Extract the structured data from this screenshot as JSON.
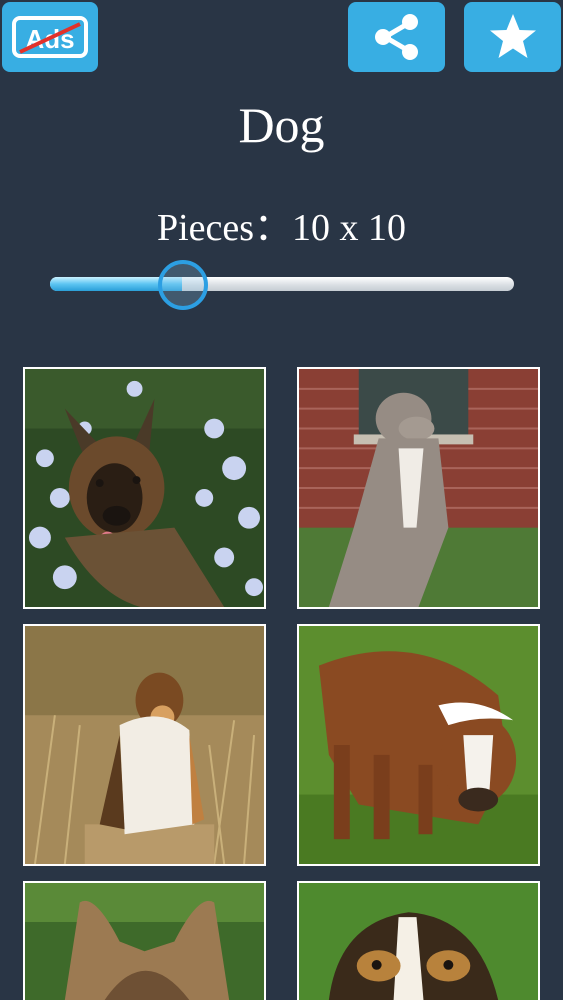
{
  "header": {
    "ads_label": "Ads",
    "share_icon": "share-icon",
    "star_icon": "star-icon"
  },
  "title": "Dog",
  "pieces": {
    "label": "Pieces：10 x 10",
    "level": 0.28
  },
  "gallery": {
    "items": [
      {
        "subject": "german-shepherd"
      },
      {
        "subject": "pit-bull"
      },
      {
        "subject": "collie"
      },
      {
        "subject": "boxer"
      },
      {
        "subject": "yorkshire-terrier"
      },
      {
        "subject": "beagle"
      }
    ]
  },
  "colors": {
    "background": "#293545",
    "accent": "#38aee3"
  }
}
